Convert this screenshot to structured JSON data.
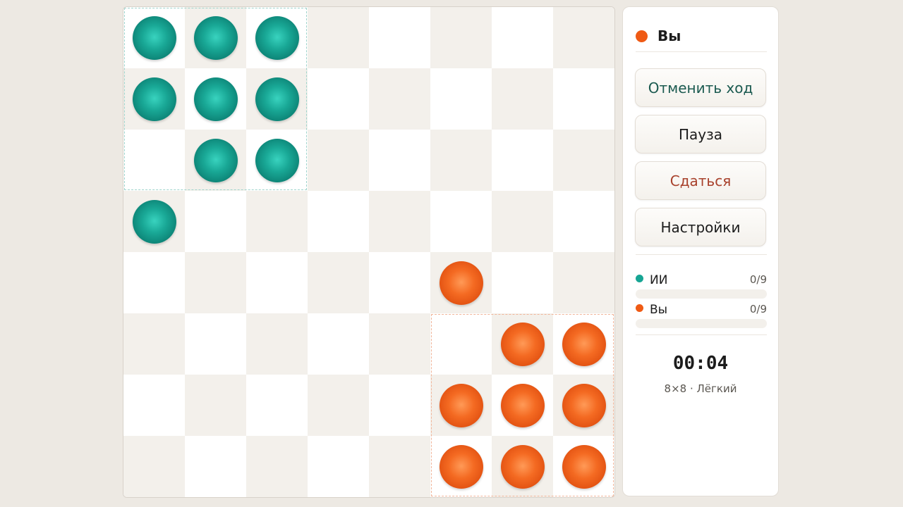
{
  "board": {
    "size": 8,
    "ai_pieces": [
      [
        0,
        0
      ],
      [
        0,
        1
      ],
      [
        0,
        2
      ],
      [
        1,
        0
      ],
      [
        1,
        1
      ],
      [
        1,
        2
      ],
      [
        2,
        1
      ],
      [
        2,
        2
      ],
      [
        3,
        0
      ]
    ],
    "player_pieces": [
      [
        4,
        5
      ],
      [
        5,
        6
      ],
      [
        5,
        7
      ],
      [
        6,
        5
      ],
      [
        6,
        6
      ],
      [
        6,
        7
      ],
      [
        7,
        5
      ],
      [
        7,
        6
      ],
      [
        7,
        7
      ]
    ]
  },
  "turn": {
    "label": "Вы",
    "color": "#ef5a14"
  },
  "buttons": {
    "undo": "Отменить ход",
    "pause": "Пауза",
    "resign": "Сдаться",
    "settings": "Настройки"
  },
  "scores": [
    {
      "name": "ИИ",
      "count": "0/9",
      "progress": 0,
      "color": "#17a594"
    },
    {
      "name": "Вы",
      "count": "0/9",
      "progress": 0,
      "color": "#ef5a14"
    }
  ],
  "timer": "00:04",
  "game_info": "8×8 · Лёгкий",
  "colors": {
    "ai": "#17a594",
    "player": "#ef5a14",
    "background": "#ede9e3"
  }
}
